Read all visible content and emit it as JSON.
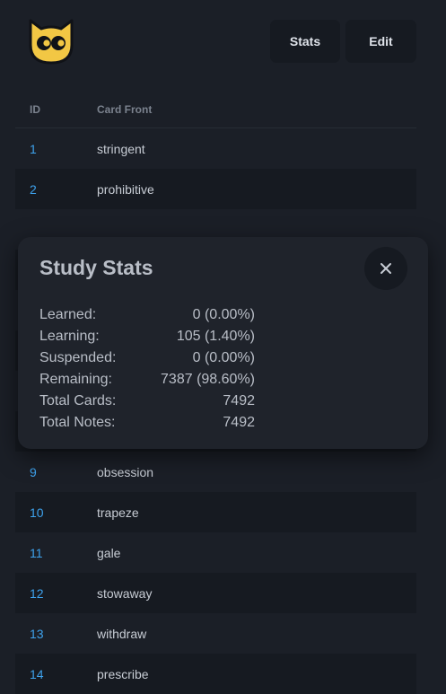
{
  "header": {
    "logo_icon": "cat-face-icon",
    "stats_label": "Stats",
    "edit_label": "Edit"
  },
  "table": {
    "columns": [
      "ID",
      "Card Front"
    ],
    "rows": [
      {
        "id": "1",
        "front": "stringent"
      },
      {
        "id": "2",
        "front": "prohibitive"
      },
      {
        "id": "9",
        "front": "obsession"
      },
      {
        "id": "10",
        "front": "trapeze"
      },
      {
        "id": "11",
        "front": "gale"
      },
      {
        "id": "12",
        "front": "stowaway"
      },
      {
        "id": "13",
        "front": "withdraw"
      },
      {
        "id": "14",
        "front": "prescribe"
      }
    ]
  },
  "modal": {
    "title": "Study Stats",
    "close_icon": "close-icon",
    "stats": [
      {
        "label": "Learned:",
        "value": "0 (0.00%)"
      },
      {
        "label": "Learning:",
        "value": "105 (1.40%)"
      },
      {
        "label": "Suspended:",
        "value": "0 (0.00%)"
      },
      {
        "label": "Remaining:",
        "value": "7387 (98.60%)"
      },
      {
        "label": "Total Cards:",
        "value": "7492"
      },
      {
        "label": "Total Notes:",
        "value": "7492"
      }
    ]
  },
  "colors": {
    "background": "#1b1f27",
    "row_alt": "#161a21",
    "accent_blue": "#3ea3ee",
    "logo_yellow": "#f2c744"
  }
}
